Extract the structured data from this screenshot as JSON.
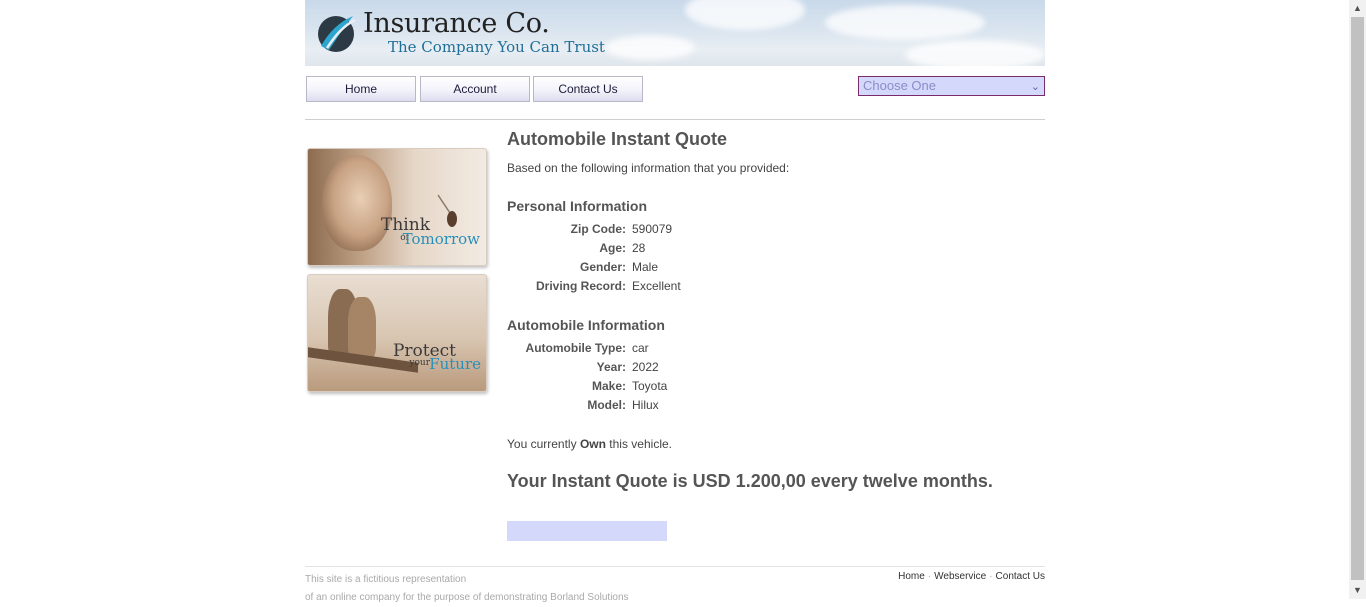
{
  "header": {
    "logo_title": "Insurance Co.",
    "logo_tagline": "The Company You Can Trust"
  },
  "nav": {
    "items": [
      {
        "label": "Home"
      },
      {
        "label": "Account"
      },
      {
        "label": "Contact Us"
      }
    ],
    "select": {
      "value": "Choose One"
    }
  },
  "side": {
    "ad1": {
      "line1": "Think",
      "small": "of",
      "line2": "Tomorrow"
    },
    "ad2": {
      "line1": "Protect",
      "small": "your",
      "line2": "Future"
    }
  },
  "main": {
    "title": "Automobile Instant Quote",
    "intro": "Based on the following information that you provided:",
    "personal": {
      "heading": "Personal Information",
      "rows": [
        {
          "label": "Zip Code:",
          "value": "590079"
        },
        {
          "label": "Age:",
          "value": "28"
        },
        {
          "label": "Gender:",
          "value": "Male"
        },
        {
          "label": "Driving Record:",
          "value": "Excellent"
        }
      ]
    },
    "auto": {
      "heading": "Automobile Information",
      "rows": [
        {
          "label": "Automobile Type:",
          "value": "car"
        },
        {
          "label": "Year:",
          "value": "2022"
        },
        {
          "label": "Make:",
          "value": "Toyota"
        },
        {
          "label": "Model:",
          "value": "Hilux"
        }
      ]
    },
    "ownership": {
      "prefix": "You currently",
      "status": "Own",
      "suffix": "this vehicle."
    },
    "quote": "Your Instant Quote is USD 1.200,00 every twelve months."
  },
  "footer": {
    "line1": "This site is a fictitious representation",
    "line2": "of an online company for the purpose of demonstrating Borland Solutions",
    "links": [
      {
        "label": "Home"
      },
      {
        "label": "Webservice"
      },
      {
        "label": "Contact Us"
      }
    ]
  },
  "colors": {
    "select_bg": "#d4d8fb",
    "select_border": "#7a2b6b",
    "accent_blue": "#1f6f98"
  }
}
